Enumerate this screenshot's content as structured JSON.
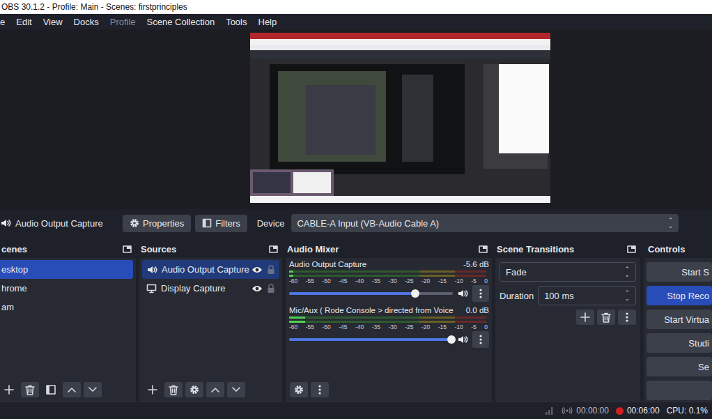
{
  "window": {
    "title": "OBS 30.1.2 - Profile: Main - Scenes: firstprinciples"
  },
  "menu": [
    {
      "label": "e",
      "disabled": false
    },
    {
      "label": "Edit",
      "disabled": false
    },
    {
      "label": "View",
      "disabled": false
    },
    {
      "label": "Docks",
      "disabled": false
    },
    {
      "label": "Profile",
      "disabled": true
    },
    {
      "label": "Scene Collection",
      "disabled": false
    },
    {
      "label": "Tools",
      "disabled": false
    },
    {
      "label": "Help",
      "disabled": false
    }
  ],
  "source_toolbar": {
    "source": "Audio Output Capture",
    "properties": "Properties",
    "filters": "Filters",
    "device_label": "Device",
    "device": "CABLE-A Input (VB-Audio Cable A)"
  },
  "scenes": {
    "title": "cenes",
    "items": [
      {
        "label": "esktop",
        "selected": true
      },
      {
        "label": "hrome",
        "selected": false
      },
      {
        "label": "am",
        "selected": false
      }
    ]
  },
  "sources": {
    "title": "Sources",
    "items": [
      {
        "label": "Audio Output Capture",
        "kind": "audio",
        "selected": true,
        "visible": true,
        "locked": false
      },
      {
        "label": "Display Capture",
        "kind": "display",
        "selected": false,
        "visible": true,
        "locked": false
      }
    ]
  },
  "mixer": {
    "title": "Audio Mixer",
    "scale": [
      "-60",
      "-55",
      "-50",
      "-45",
      "-40",
      "-35",
      "-30",
      "-25",
      "-20",
      "-15",
      "-10",
      "-5",
      "0"
    ],
    "channels": [
      {
        "name": "Audio Output Capture",
        "reading": "-5.6 dB",
        "meter_level": 0.02,
        "volume_level": 0.77,
        "muted": false
      },
      {
        "name": "Mic/Aux ( Rode Console > directed from Voice",
        "reading": "0.0 dB",
        "meter_level": 0.08,
        "volume_level": 0.99,
        "muted": false
      }
    ]
  },
  "transitions": {
    "title": "Scene Transitions",
    "transition": "Fade",
    "duration_label": "Duration",
    "duration": "100 ms"
  },
  "controls": {
    "title": "Controls",
    "buttons": [
      {
        "label": "Start S",
        "active": false
      },
      {
        "label": "Stop Reco",
        "active": true
      },
      {
        "label": "Start Virtua",
        "active": false
      },
      {
        "label": "Studi",
        "active": false
      },
      {
        "label": "Se",
        "active": false
      },
      {
        "label": "",
        "active": false
      }
    ]
  },
  "status_bar": {
    "stream_time": "00:00:00",
    "record_time": "00:06:00",
    "cpu": "CPU: 0.1%",
    "recording": true
  }
}
